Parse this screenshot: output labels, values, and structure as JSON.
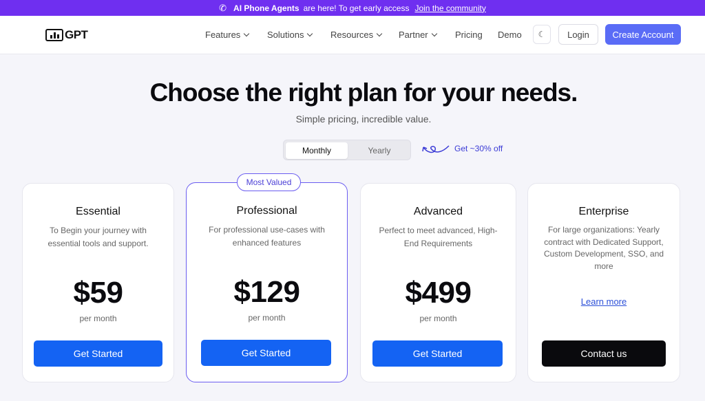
{
  "banner": {
    "highlight": "AI Phone Agents",
    "text": "are here! To get early access",
    "link": "Join the community"
  },
  "nav": {
    "logo_text": "GPT",
    "items": [
      {
        "label": "Features",
        "has_dropdown": true
      },
      {
        "label": "Solutions",
        "has_dropdown": true
      },
      {
        "label": "Resources",
        "has_dropdown": true
      },
      {
        "label": "Partner",
        "has_dropdown": true
      },
      {
        "label": "Pricing",
        "has_dropdown": false
      },
      {
        "label": "Demo",
        "has_dropdown": false
      }
    ],
    "theme_icon": "moon-icon",
    "login": "Login",
    "create_account": "Create Account"
  },
  "hero": {
    "title": "Choose the right plan for your needs.",
    "subtitle": "Simple pricing, incredible value."
  },
  "billing_toggle": {
    "options": [
      "Monthly",
      "Yearly"
    ],
    "selected": "Monthly",
    "promo": "Get ~30% off"
  },
  "plans": [
    {
      "name": "Essential",
      "description": "To Begin your journey with essential tools and support.",
      "price": "$59",
      "period": "per month",
      "cta": "Get Started"
    },
    {
      "name": "Professional",
      "badge": "Most Valued",
      "description": "For professional use-cases with enhanced features",
      "price": "$129",
      "period": "per month",
      "cta": "Get Started"
    },
    {
      "name": "Advanced",
      "description": "Perfect to meet advanced, High-End Requirements",
      "price": "$499",
      "period": "per month",
      "cta": "Get Started"
    },
    {
      "name": "Enterprise",
      "description": "For large organizations: Yearly contract with Dedicated Support, Custom Development, SSO, and more",
      "link": "Learn more",
      "cta": "Contact us"
    }
  ],
  "colors": {
    "banner": "#6f2ff0",
    "primary": "#1463f3",
    "create_account": "#5a6cf6",
    "featured_border": "#6a5cf0",
    "enterprise_cta": "#0a0a0d"
  }
}
